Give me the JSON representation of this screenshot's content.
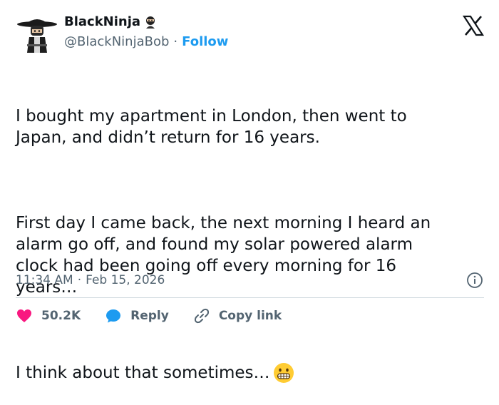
{
  "author": {
    "display_name": "BlackNinja",
    "handle": "@BlackNinjaBob",
    "separator": "·",
    "follow_label": "Follow"
  },
  "tweet": {
    "paragraphs": [
      "I bought my apartment in London, then went to\nJapan, and didn’t return for 16 years.",
      "First day I came back, the next morning I heard an\nalarm go off, and found my solar powered alarm\nclock had been going off every morning for 16\nyears…",
      "I think about that sometimes…"
    ],
    "emoji": "grimacing-face-emoji"
  },
  "meta": {
    "time": "11:34 AM",
    "separator": "·",
    "date": "Feb 15, 2026"
  },
  "actions": {
    "like_count": "50.2K",
    "reply_label": "Reply",
    "copy_label": "Copy link"
  },
  "colors": {
    "text": "#0f1419",
    "secondary": "#536471",
    "accent": "#1d9bf0",
    "like": "#f91880",
    "divider": "#cfd9de"
  },
  "icons": [
    "ninja-avatar",
    "ninja-badge-icon",
    "x-logo-icon",
    "info-icon",
    "heart-icon",
    "reply-bubble-icon",
    "link-icon"
  ]
}
